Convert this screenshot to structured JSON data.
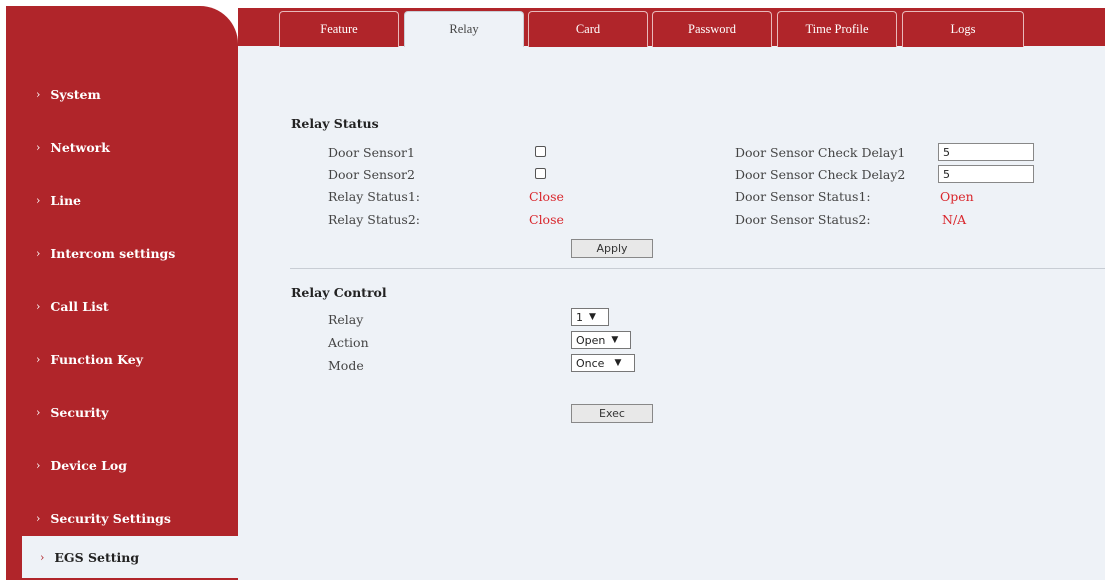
{
  "sidebar": {
    "items": [
      {
        "label": "System"
      },
      {
        "label": "Network"
      },
      {
        "label": "Line"
      },
      {
        "label": "Intercom settings"
      },
      {
        "label": "Call List"
      },
      {
        "label": "Function Key"
      },
      {
        "label": "Security"
      },
      {
        "label": "Device Log"
      },
      {
        "label": "Security Settings"
      },
      {
        "label": "EGS Setting"
      }
    ]
  },
  "tabs": [
    {
      "label": "Feature"
    },
    {
      "label": "Relay"
    },
    {
      "label": "Card"
    },
    {
      "label": "Password"
    },
    {
      "label": "Time Profile"
    },
    {
      "label": "Logs"
    }
  ],
  "relay_status": {
    "title": "Relay Status",
    "door_sensor1": "Door Sensor1",
    "door_sensor2": "Door Sensor2",
    "relay_status1_label": "Relay Status1:",
    "relay_status2_label": "Relay Status2:",
    "relay_status1_value": "Close",
    "relay_status2_value": "Close",
    "check_delay1_label": "Door Sensor Check Delay1",
    "check_delay2_label": "Door Sensor Check Delay2",
    "check_delay1_value": "5",
    "check_delay2_value": "5",
    "sensor_status1_label": "Door Sensor Status1:",
    "sensor_status2_label": "Door Sensor Status2:",
    "sensor_status1_value": "Open",
    "sensor_status2_value": "N/A",
    "apply_label": "Apply"
  },
  "relay_control": {
    "title": "Relay Control",
    "relay_label": "Relay",
    "relay_value": "1",
    "action_label": "Action",
    "action_value": "Open",
    "mode_label": "Mode",
    "mode_value": "Once",
    "exec_label": "Exec"
  },
  "colors": {
    "brand": "#b0252a",
    "panel": "#eef2f7",
    "status_red": "#d9262c"
  }
}
